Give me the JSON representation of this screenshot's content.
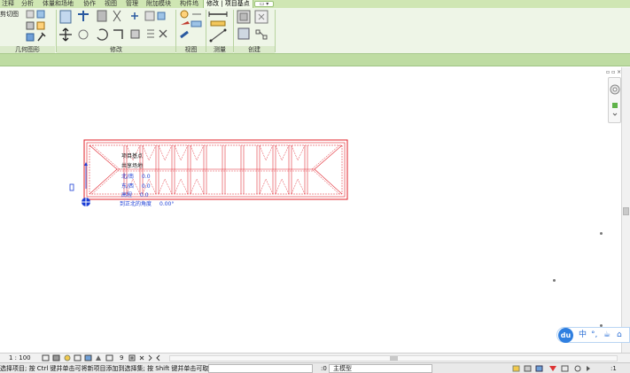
{
  "ribbon": {
    "tabs": [
      {
        "label": "注释"
      },
      {
        "label": "分析"
      },
      {
        "label": "体量和场地"
      },
      {
        "label": "协作"
      },
      {
        "label": "视图"
      },
      {
        "label": "管理"
      },
      {
        "label": "附加模块"
      },
      {
        "label": "构件坞"
      },
      {
        "label": "修改 | 项目基点"
      }
    ],
    "extra_tab_symbol": "▭ ▾",
    "dropdown_text": "剪切图",
    "panels": [
      "几何图形",
      "修改",
      "视图",
      "测量",
      "创建"
    ]
  },
  "drawing": {
    "labels": [
      "项目基点",
      "共享场地",
      "北/南",
      "东/西",
      "高程",
      "到正北的角度"
    ],
    "values": [
      "0.0",
      "0.0",
      "0.0",
      "0.00°"
    ]
  },
  "view_control": {
    "scale": "1 : 100",
    "value_9": "9"
  },
  "status_bar": {
    "hint": "选择项目; 按 Ctrl 键并单击可将新项目添加到选择集; 按 Shift 键并单击可取消",
    "zero": ":0",
    "model_dropdown": "主模型",
    "filter_count": ":1"
  },
  "ime": {
    "logo": "du",
    "items": [
      "中",
      "°,",
      "☕",
      "⌂"
    ]
  },
  "colors": {
    "tab_bar": "#cfe6b3",
    "ribbon": "#eef5e7",
    "strip": "#bedca2",
    "drawing_red": "#e0202a",
    "drawing_blue": "#1c3fd6",
    "ime_blue": "#2f7fe0"
  }
}
